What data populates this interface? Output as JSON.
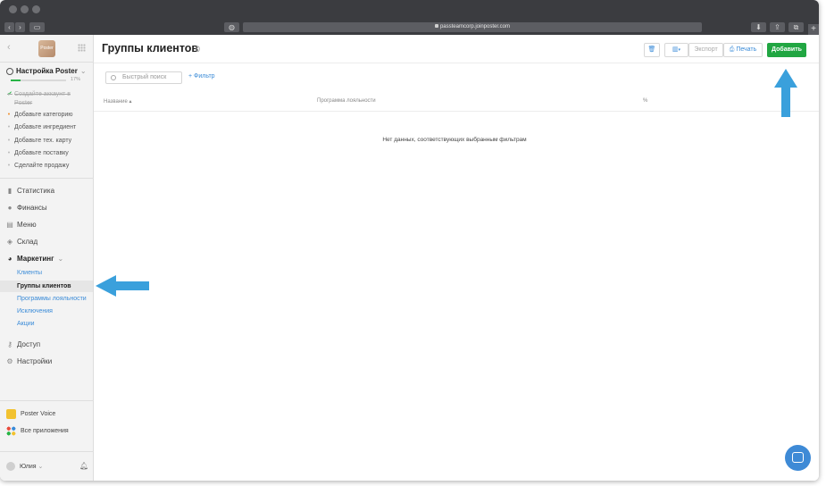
{
  "browser": {
    "url": "passteamcorp.joinposter.com"
  },
  "sidebar": {
    "logo_text": "Poster",
    "setup": {
      "title": "Настройка Poster",
      "progress_percent": 17,
      "progress_label": "17%",
      "tasks": [
        {
          "label": "Создайте аккаунт в Poster",
          "done": true
        },
        {
          "label": "Добавьте категорию",
          "done": false,
          "current": true
        },
        {
          "label": "Добавьте ингредиент",
          "done": false
        },
        {
          "label": "Добавьте тех. карту",
          "done": false
        },
        {
          "label": "Добавьте поставку",
          "done": false
        },
        {
          "label": "Сделайте продажу",
          "done": false
        }
      ]
    },
    "nav": [
      {
        "label": "Статистика"
      },
      {
        "label": "Финансы"
      },
      {
        "label": "Меню"
      },
      {
        "label": "Склад"
      },
      {
        "label": "Маркетинг"
      }
    ],
    "marketing_items": [
      {
        "label": "Клиенты"
      },
      {
        "label": "Группы клиентов",
        "active": true
      },
      {
        "label": "Программы лояльности"
      },
      {
        "label": "Исключения"
      },
      {
        "label": "Акции"
      }
    ],
    "nav_bottom": [
      {
        "label": "Доступ"
      },
      {
        "label": "Настройки"
      }
    ],
    "apps": [
      {
        "label": "Poster Voice"
      },
      {
        "label": "Все приложения"
      }
    ],
    "user": {
      "name": "Юлия"
    }
  },
  "main": {
    "title": "Группы клиентов",
    "count": "0",
    "toolbar": {
      "export_label": "Экспорт",
      "print_label": "Печать",
      "add_label": "Добавить"
    },
    "search_placeholder": "Быстрый поиск",
    "filter_label": "Фильтр",
    "columns": [
      "Название",
      "Программа лояльности",
      "%"
    ],
    "empty_message": "Нет данных, соответствующих выбранным фильтрам"
  },
  "colors": {
    "accent": "#3a8bd8",
    "add_button": "#21a642",
    "arrow": "#3aa0dc",
    "progress": "#28b446"
  }
}
